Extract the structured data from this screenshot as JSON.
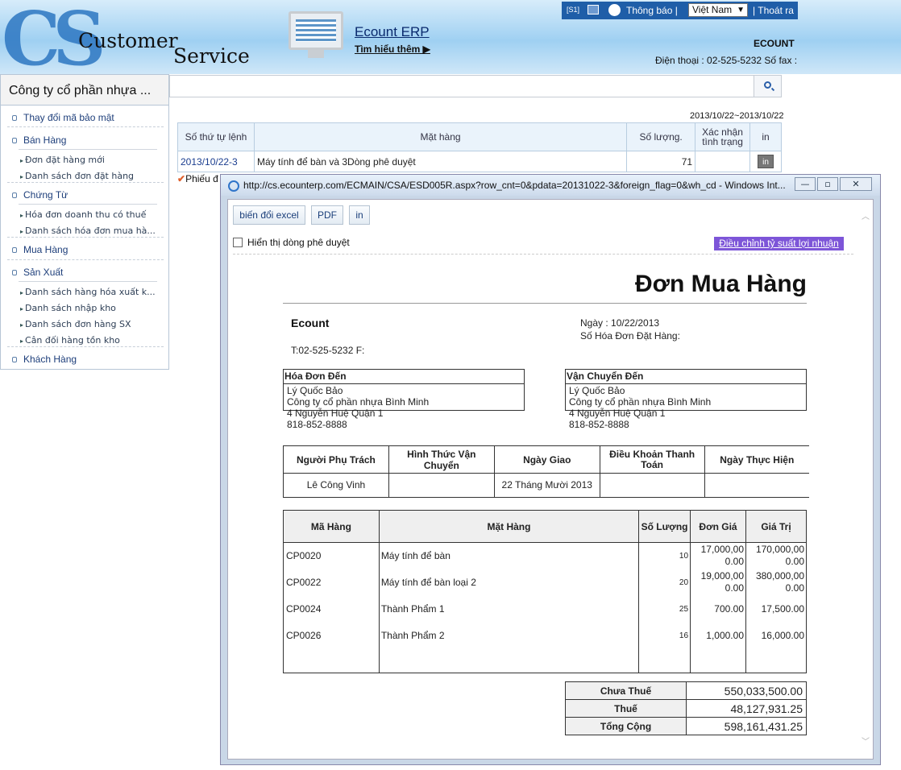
{
  "header": {
    "logo_cs": "CS",
    "logo_line1": "Customer",
    "logo_line2": "Service",
    "erp_title": "Ecount ERP",
    "erp_more": "Tìm hiểu thêm ▶",
    "s1": "[S1]",
    "notification": "Thông báo |",
    "language": "Việt Nam",
    "logout": "| Thoát ra",
    "company_code": "ECOUNT",
    "phone_fax": "Điện thoại : 02-525-5232 Số fax :"
  },
  "sidebar": {
    "company": "Công ty cổ phần nhựa ...",
    "groups": [
      {
        "label": "Thay đổi mã bảo mật"
      },
      {
        "label": "Bán Hàng",
        "items": [
          "Đơn đặt hàng mới",
          "Danh sách đơn đặt hàng"
        ]
      },
      {
        "label": "Chứng Từ",
        "items": [
          "Hóa đơn doanh thu có thuế",
          "Danh sách hóa đơn mua hà..."
        ]
      },
      {
        "label": "Mua Hàng"
      },
      {
        "label": "Sản Xuất",
        "items": [
          "Danh sách hàng hóa xuất k...",
          "Danh sách nhập kho",
          "Danh sách đơn hàng SX",
          "Cân đối hàng tồn kho"
        ]
      },
      {
        "label": "Khách Hàng"
      }
    ]
  },
  "main": {
    "date_range": "2013/10/22~2013/10/22",
    "columns": [
      "Số thứ tự lệnh",
      "Mặt hàng",
      "Số lượng.",
      "Xác nhận tình trạng",
      "in"
    ],
    "row": {
      "order_no": "2013/10/22-3",
      "item": "Máy tính để bàn và 3Dòng phê duyệt",
      "qty": "71",
      "status": "",
      "print": "in"
    },
    "footer_note": "Phiếu đ"
  },
  "popup": {
    "url": "http://cs.ecounterp.com/ECMAIN/CSA/ESD005R.aspx?row_cnt=0&pdata=20131022-3&foreign_flag=0&wh_cd - Windows Int...",
    "buttons": {
      "excel": "biến đổi excel",
      "pdf": "PDF",
      "print": "in"
    },
    "show_approval": "Hiển thị dòng phê duyệt",
    "profit_adjust": "Điều chỉnh tỷ suất lợi nhuận",
    "doc": {
      "title": "Đơn Mua Hàng",
      "company": "Ecount",
      "tel": "T:02-525-5232 F:",
      "date": "Ngày : 10/22/2013",
      "po_no": "Số Hóa Đơn Đặt Hàng:",
      "bill_to": {
        "header": "Hóa Đơn Đến",
        "lines": [
          "Lý Quốc Bảo",
          "Công ty cổ phần nhựa Bình Minh",
          "4 Nguyễn Huệ Quận 1",
          "818-852-8888"
        ]
      },
      "ship_to": {
        "header": "Vận Chuyển Đến",
        "lines": [
          "Lý Quốc Bảo",
          "Công ty cổ phần nhựa Bình Minh",
          "4 Nguyễn Huệ Quận 1",
          "818-852-8888"
        ]
      },
      "info_headers": [
        "Người Phụ Trách",
        "Hình Thức Vận Chuyển",
        "Ngày Giao",
        "Điều Khoản Thanh Toán",
        "Ngày Thực Hiện"
      ],
      "info_values": [
        "Lê Công Vinh",
        "",
        "22 Tháng Mười 2013",
        "",
        ""
      ],
      "item_headers": [
        "Mã Hàng",
        "Mặt Hàng",
        "Số Lượng",
        "Đơn Giá",
        "Giá Trị"
      ],
      "items": [
        {
          "code": "CP0020",
          "name": "Máy tính để bàn",
          "qty": "10",
          "price": "17,000,00 0.00",
          "value": "170,000,00 0.00"
        },
        {
          "code": "CP0022",
          "name": "Máy tính để bàn loại 2",
          "qty": "20",
          "price": "19,000,00 0.00",
          "value": "380,000,00 0.00"
        },
        {
          "code": "CP0024",
          "name": "Thành Phẩm 1",
          "qty": "25",
          "price": "700.00",
          "value": "17,500.00"
        },
        {
          "code": "CP0026",
          "name": "Thành Phẩm 2",
          "qty": "16",
          "price": "1,000.00",
          "value": "16,000.00"
        }
      ],
      "totals": [
        {
          "label": "Chưa Thuế",
          "value": "550,033,500.00"
        },
        {
          "label": "Thuế",
          "value": "48,127,931.25"
        },
        {
          "label": "Tổng Cộng",
          "value": "598,161,431.25"
        }
      ]
    }
  }
}
